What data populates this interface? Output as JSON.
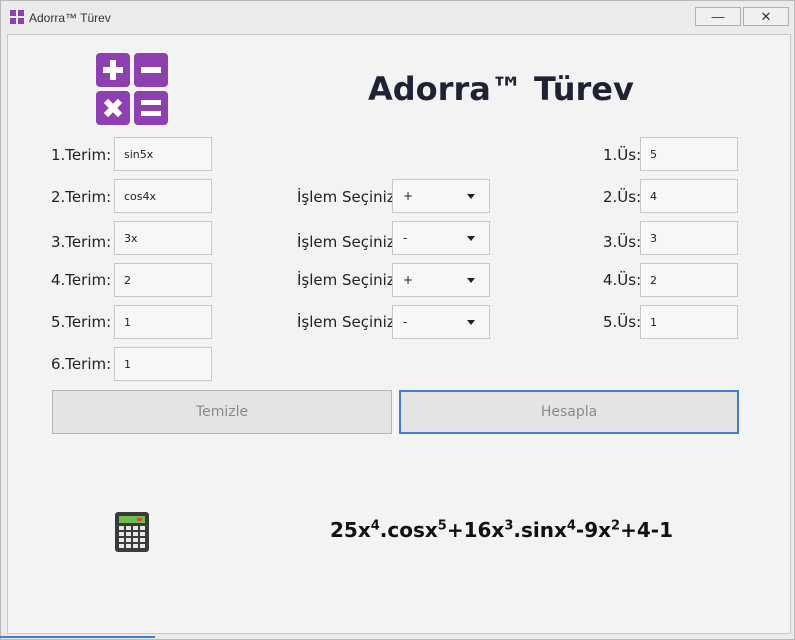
{
  "window": {
    "title": "Adorra™ Türev",
    "minimize_label": "—",
    "close_label": "✕"
  },
  "header": {
    "title": "Adorra™ Türev"
  },
  "icons": {
    "logo": "calculator-operators-icon",
    "calc": "calculator-icon"
  },
  "colors": {
    "accent": "#8e3fb0",
    "focus": "#3d7dcb"
  },
  "terms": [
    {
      "label": "1.Terim:",
      "value": "sin5x"
    },
    {
      "label": "2.Terim:",
      "value": "cos4x"
    },
    {
      "label": "3.Terim:",
      "value": "3x"
    },
    {
      "label": "4.Terim:",
      "value": "2"
    },
    {
      "label": "5.Terim:",
      "value": "1"
    },
    {
      "label": "6.Terim:",
      "value": "1"
    }
  ],
  "operations": [
    {
      "label": "İşlem Seçiniz:",
      "value": "+"
    },
    {
      "label": "İşlem Seçiniz:",
      "value": "-"
    },
    {
      "label": "İşlem Seçiniz:",
      "value": "+"
    },
    {
      "label": "İşlem Seçiniz:",
      "value": "-"
    }
  ],
  "exponents": [
    {
      "label": "1.Üs:",
      "value": "5"
    },
    {
      "label": "2.Üs:",
      "value": "4"
    },
    {
      "label": "3.Üs:",
      "value": "3"
    },
    {
      "label": "4.Üs:",
      "value": "2"
    },
    {
      "label": "5.Üs:",
      "value": "1"
    }
  ],
  "buttons": {
    "clear": "Temizle",
    "calculate": "Hesapla"
  },
  "result": {
    "parts": [
      {
        "text": "25x",
        "sup": "4"
      },
      {
        "text": ".cosx",
        "sup": "5"
      },
      {
        "text": "+16x",
        "sup": "3"
      },
      {
        "text": ".sinx",
        "sup": "4"
      },
      {
        "text": "-9x",
        "sup": "2"
      },
      {
        "text": "+4-1",
        "sup": ""
      }
    ]
  }
}
